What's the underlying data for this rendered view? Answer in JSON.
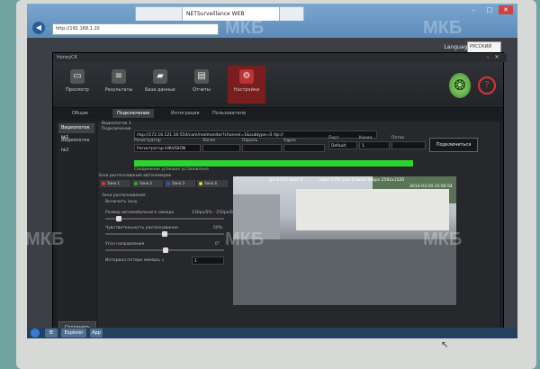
{
  "browser": {
    "tabs": [
      {
        "label": "",
        "active": false
      },
      {
        "label": "NETSurveillance WEB",
        "active": true
      },
      {
        "label": "",
        "active": false
      }
    ],
    "address": "http://192.168.1.10",
    "back_icon": "back-arrow-icon",
    "window_controls": [
      "–",
      "□",
      "✕"
    ]
  },
  "language": {
    "label": "Language",
    "value": "РУССКИЙ"
  },
  "app": {
    "title": "HoneyCK",
    "toolbar": [
      {
        "label": "Просмотр",
        "icon": "monitor-icon"
      },
      {
        "label": "Результаты",
        "icon": "results-icon"
      },
      {
        "label": "База данных",
        "icon": "car-icon"
      },
      {
        "label": "Отчеты",
        "icon": "reports-icon"
      },
      {
        "label": "Настройки",
        "icon": "settings-icon",
        "active": true
      }
    ],
    "subtabs": [
      "Общие",
      "Подключение",
      "Интеграция",
      "Пользователи"
    ],
    "active_subtab": 1,
    "sidebar": [
      "Видеопоток №1",
      "Видеопоток №2"
    ],
    "save_label": "Сохранить"
  },
  "connection": {
    "stream_label": "Видеопоток 1",
    "connect_label": "Подключение",
    "url": "rtsp://172.16.121.16:554/cam/realmonitor?channel=1&subtype=0 rtp://",
    "recorder_label": "Регистратор",
    "recorder_value": "Регистратор HIKVISION",
    "login_label": "Логин",
    "password_label": "Пароль",
    "address_label": "Адрес",
    "port_label": "Порт",
    "port_value": "Default",
    "channel_label": "Канал",
    "channel_value": "1",
    "stream_type_label": "Поток",
    "connect_button": "Подключиться",
    "status_text": "Соединение успешно установлено",
    "progress": 1.0
  },
  "recognition": {
    "zone_title": "Зона распознавания автономеров",
    "zones": [
      {
        "label": "Зона 1",
        "color": "#d33"
      },
      {
        "label": "Зона 2",
        "color": "#3a3"
      },
      {
        "label": "Зона 3",
        "color": "#35c"
      },
      {
        "label": "Зона 4",
        "color": "#dc3"
      }
    ],
    "zone_section": "Зона распознавания",
    "zone_toggle": "Включить зону",
    "size_label": "Размер автомобильного номера",
    "size_value": "130px/0% - 250px/0%",
    "sensitivity_label": "Чувствительность распознавания",
    "sensitivity_value": "50%",
    "sensitivity_level": 0.5,
    "angle_label": "Угол направления",
    "angle_value": "0°",
    "timeout_label": "Интервал потери номера, с",
    "timeout_value": "1"
  },
  "camera": {
    "overlay_left": "fps  6.655 kbps 0",
    "overlay_right": "kbps  0.0% skip 0  audio 0kbps  2592x1520",
    "timestamp": "2014-03-29 15:00:54"
  },
  "taskbar": [
    "IE",
    "Explorer",
    "App"
  ],
  "watermark": "МКБ"
}
